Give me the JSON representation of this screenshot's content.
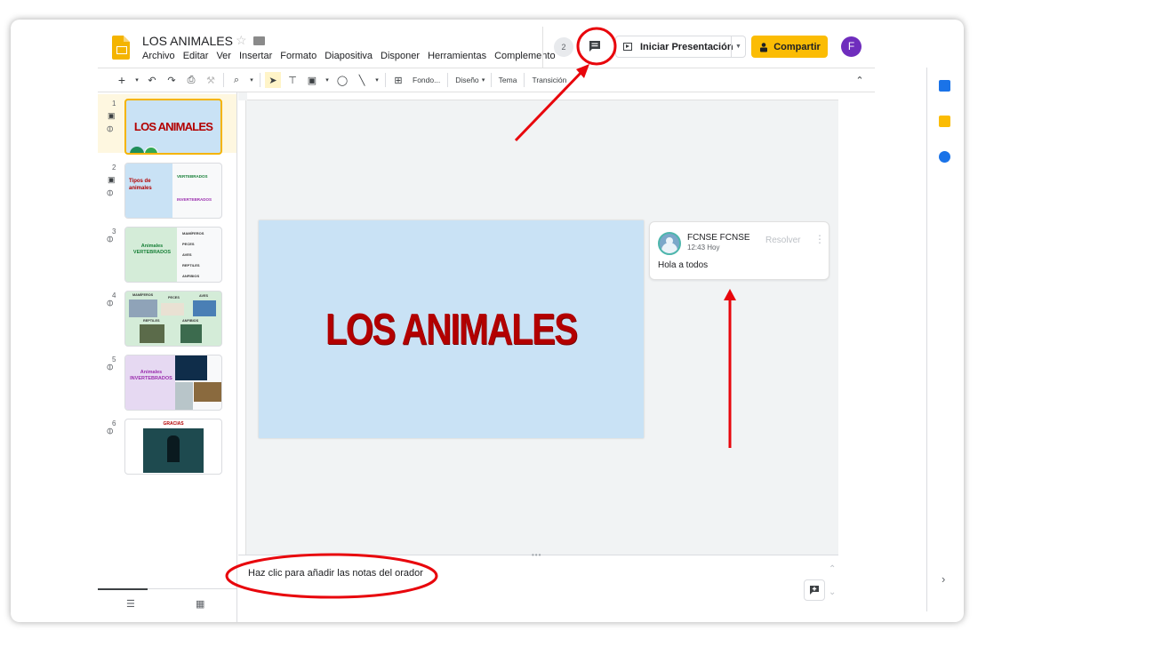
{
  "header": {
    "title": "LOS ANIMALES",
    "menu": [
      "Archivo",
      "Editar",
      "Ver",
      "Insertar",
      "Formato",
      "Diapositiva",
      "Disponer",
      "Herramientas",
      "Complemento"
    ],
    "collaborators_count": "2",
    "present_label": "Iniciar Presentación",
    "share_label": "Compartir",
    "avatar_letter": "F"
  },
  "toolbar": {
    "background_label": "Fondo...",
    "layout_label": "Diseño",
    "theme_label": "Tema",
    "transition_label": "Transición"
  },
  "slides": [
    {
      "num": "1",
      "title": "LOS ANIMALES"
    },
    {
      "num": "2",
      "title": "Tipos de animales",
      "items": [
        "VERTEBRADOS",
        "INVERTEBRADOS"
      ]
    },
    {
      "num": "3",
      "title": "Animales VERTEBRADOS",
      "items": [
        "MAMÍFEROS",
        "PECES",
        "AVES",
        "REPTILES",
        "ANFIBIOS"
      ]
    },
    {
      "num": "4",
      "items": [
        "MAMÍFEROS",
        "PECES",
        "AVES",
        "REPTILES",
        "ANFIBIOS"
      ]
    },
    {
      "num": "5",
      "title": "Animales INVERTEBRADOS"
    },
    {
      "num": "6",
      "title": "GRACIAS"
    }
  ],
  "main_slide": {
    "title": "LOS ANIMALES"
  },
  "comment": {
    "author": "FCNSE FCNSE",
    "time": "12:43 Hoy",
    "resolve_label": "Resolver",
    "text": "Hola a todos"
  },
  "notes": {
    "placeholder": "Haz clic para añadir las notas del orador"
  },
  "colors": {
    "accent": "#fbbc04",
    "annotation": "#e8060c",
    "slide_title": "#b30000"
  }
}
